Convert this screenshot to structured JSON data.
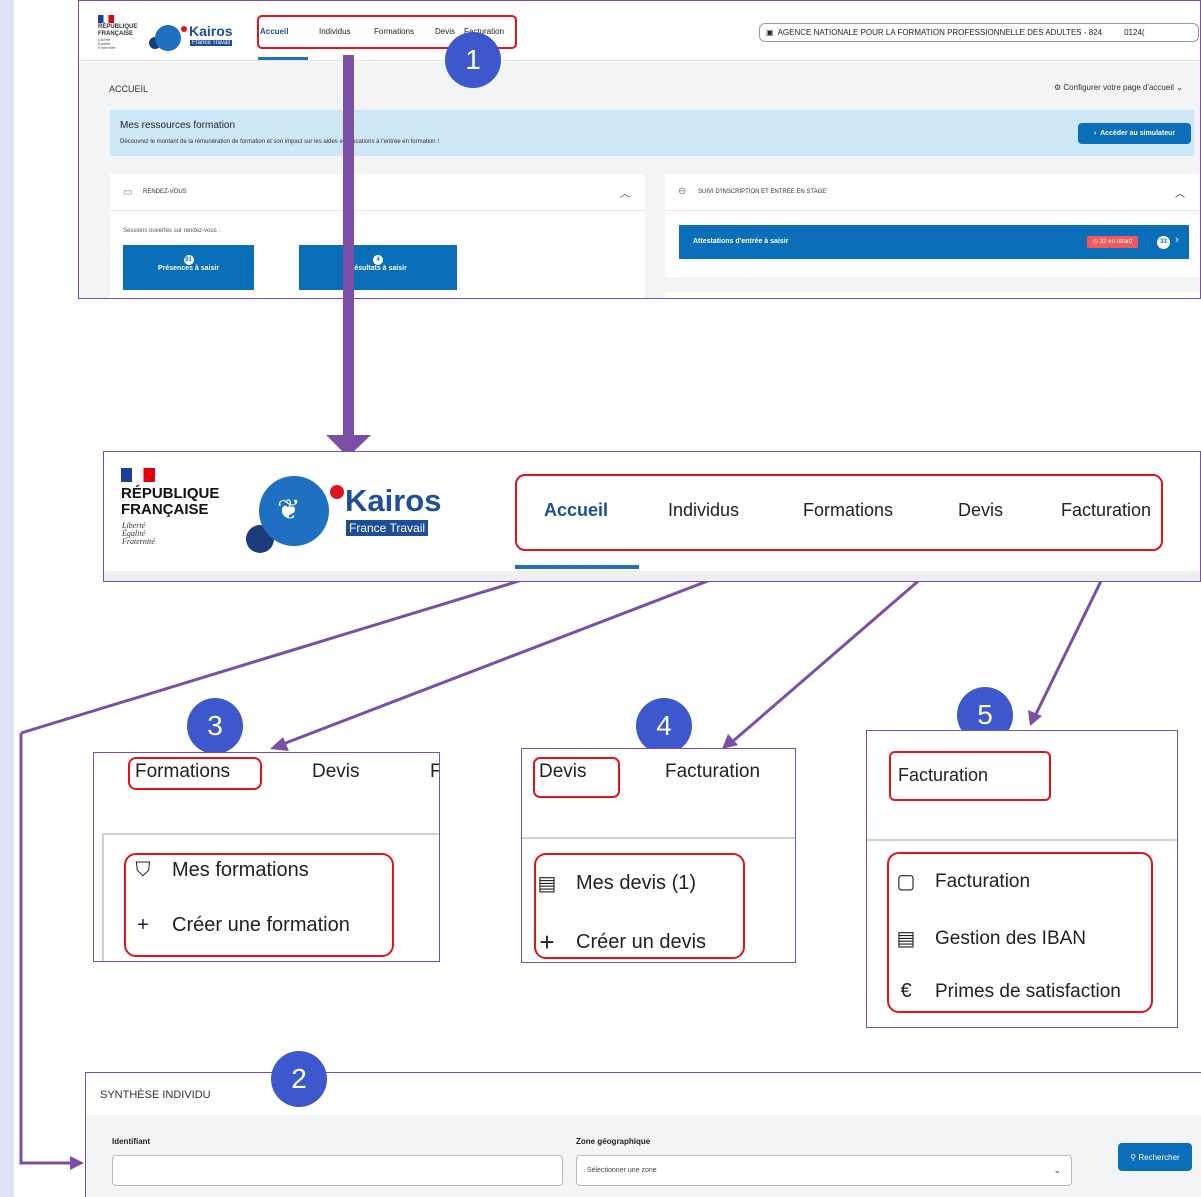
{
  "brand": {
    "republic": [
      "RÉPUBLIQUE",
      "FRANÇAISE"
    ],
    "motto": [
      "Liberté",
      "Égalité",
      "Fraternité"
    ],
    "app_name": "Kairos",
    "app_tag": "France Travail"
  },
  "nav": {
    "items": [
      "Accueil",
      "Individus",
      "Formations",
      "Devis",
      "Facturation"
    ],
    "active": "Accueil"
  },
  "topbar": {
    "organization": "AGENCE NATIONALE POUR LA FORMATION PROFESSIONNELLE DES ADULTES - 824",
    "org_code": "0124("
  },
  "home": {
    "title": "ACCUEIL",
    "configure": "Configurer votre page d'accueil",
    "banner_title": "Mes ressources formation",
    "banner_text": "Découvrez le montant de la rémunération de formation et son impact sur les aides et allocations à l'entrée en formation !",
    "banner_button": "Accéder au simulateur",
    "rdv_title": "RENDEZ-VOUS",
    "rdv_sessions": "Sessions ouvertes sur rendez-vous :",
    "presences_count": "91",
    "presences_label": "Présences à saisir",
    "resultats_count": "4",
    "resultats_label": "Résultats à saisir",
    "suivi_title": "SUIVI D'INSCRIPTION ET ENTRÉE EN STAGE",
    "attestations_label": "Attestations d'entrée à saisir",
    "retard_label": "32 en retard",
    "attestations_count": "33"
  },
  "badges": [
    "1",
    "2",
    "3",
    "4",
    "5"
  ],
  "formations_menu": {
    "header": [
      "Formations",
      "Devis",
      "F"
    ],
    "items": [
      {
        "icon": "graduation-cap-icon",
        "label": "Mes formations"
      },
      {
        "icon": "plus-icon",
        "label": "Créer une formation"
      }
    ]
  },
  "devis_menu": {
    "header": [
      "Devis",
      "Facturation"
    ],
    "items": [
      {
        "icon": "document-list-icon",
        "label": "Mes devis (1)"
      },
      {
        "icon": "plus-icon",
        "label": "Créer un devis"
      }
    ]
  },
  "facturation_menu": {
    "header": "Facturation",
    "items": [
      {
        "icon": "receipt-icon",
        "label": "Facturation"
      },
      {
        "icon": "card-icon",
        "label": "Gestion des IBAN"
      },
      {
        "icon": "euro-icon",
        "label": "Primes de satisfaction"
      }
    ]
  },
  "synthese": {
    "title": "SYNTHÈSE INDIVIDU",
    "identifiant_label": "Identifiant",
    "identifiant_value": "",
    "zone_label": "Zone géographique",
    "zone_placeholder": "Sélectionner une zone",
    "search_button": "Rechercher"
  },
  "colors": {
    "purple": "#7b4fa6",
    "red": "#e0141e",
    "badge": "#3d57cc",
    "primary": "#0a6fb8",
    "banner_bg": "#cfe8f8"
  }
}
